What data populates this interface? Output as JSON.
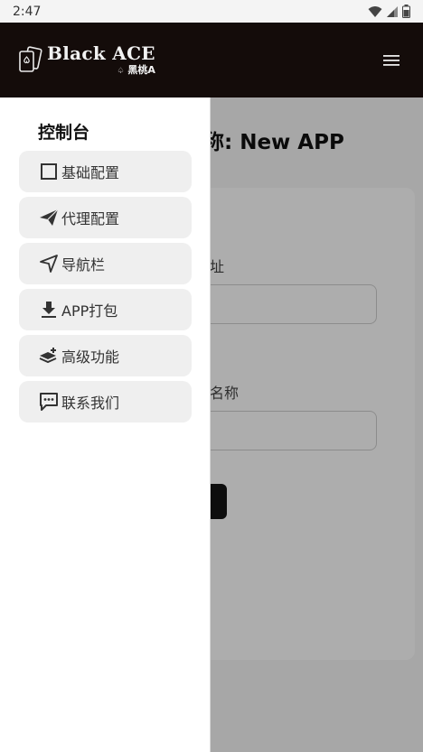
{
  "status_bar": {
    "time": "2:47"
  },
  "header": {
    "brand_name": "Black ACE",
    "brand_sub": "黑桃A"
  },
  "main": {
    "title": "称: New APP",
    "card": {
      "field1_label": "址",
      "field1_value": "",
      "field2_label": "名称",
      "field2_value": ""
    }
  },
  "drawer": {
    "title": "控制台",
    "items": [
      {
        "label": "基础配置",
        "icon": "square-icon"
      },
      {
        "label": "代理配置",
        "icon": "paper-plane-icon"
      },
      {
        "label": "导航栏",
        "icon": "navigation-icon"
      },
      {
        "label": "APP打包",
        "icon": "download-icon"
      },
      {
        "label": "高级功能",
        "icon": "layers-plus-icon"
      },
      {
        "label": "联系我们",
        "icon": "chat-icon"
      }
    ]
  },
  "colors": {
    "header_bg": "#140c0a",
    "drawer_item_bg": "#efefef",
    "scrim": "rgba(0,0,0,0.32)"
  }
}
